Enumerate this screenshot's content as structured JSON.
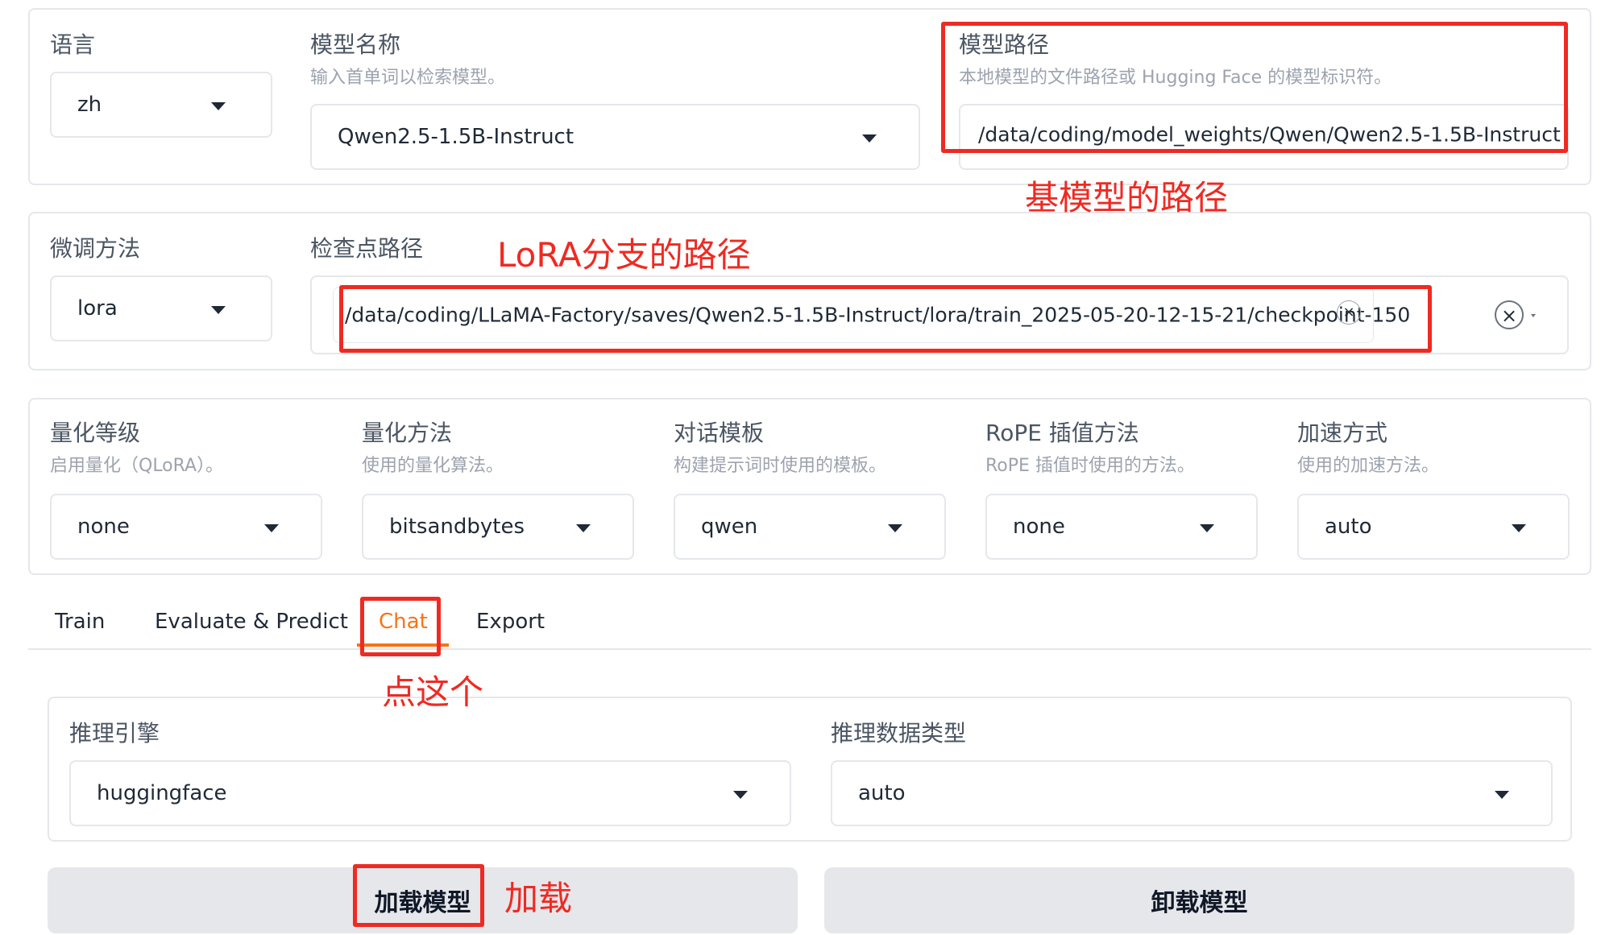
{
  "model": {
    "language": {
      "label": "语言",
      "value": "zh"
    },
    "model_name": {
      "label": "模型名称",
      "info": "输入首单词以检索模型。",
      "value": "Qwen2.5-1.5B-Instruct"
    },
    "model_path": {
      "label": "模型路径",
      "info": "本地模型的文件路径或 Hugging Face 的模型标识符。",
      "value": "/data/coding/model_weights/Qwen/Qwen2.5-1.5B-Instruct"
    }
  },
  "finetune": {
    "method": {
      "label": "微调方法",
      "value": "lora"
    },
    "checkpoint": {
      "label": "检查点路径",
      "chip_value": "/data/coding/LLaMA-Factory/saves/Qwen2.5-1.5B-Instruct/lora/train_2025-05-20-12-15-21/checkpoint-150",
      "chip_remove": "×",
      "clear": "×"
    }
  },
  "advanced": [
    {
      "label": "量化等级",
      "info": "启用量化（QLoRA）。",
      "value": "none"
    },
    {
      "label": "量化方法",
      "info": "使用的量化算法。",
      "value": "bitsandbytes"
    },
    {
      "label": "对话模板",
      "info": "构建提示词时使用的模板。",
      "value": "qwen"
    },
    {
      "label": "RoPE 插值方法",
      "info": "RoPE 插值时使用的方法。",
      "value": "none"
    },
    {
      "label": "加速方式",
      "info": "使用的加速方法。",
      "value": "auto"
    }
  ],
  "tabs": [
    "Train",
    "Evaluate & Predict",
    "Chat",
    "Export"
  ],
  "active_tab": "Chat",
  "chat": {
    "infer_backend": {
      "label": "推理引擎",
      "value": "huggingface"
    },
    "infer_dtype": {
      "label": "推理数据类型",
      "value": "auto"
    },
    "load_button": "加载模型",
    "unload_button": "卸载模型"
  },
  "annotations": {
    "base_model_path": "基模型的路径",
    "lora_path": "LoRA分支的路径",
    "click_this": "点这个",
    "load": "加载"
  },
  "colors": {
    "accent": "#f97316",
    "annotation": "#ef2a22",
    "button_bg": "#e5e7eb",
    "border": "#e5e7eb"
  }
}
